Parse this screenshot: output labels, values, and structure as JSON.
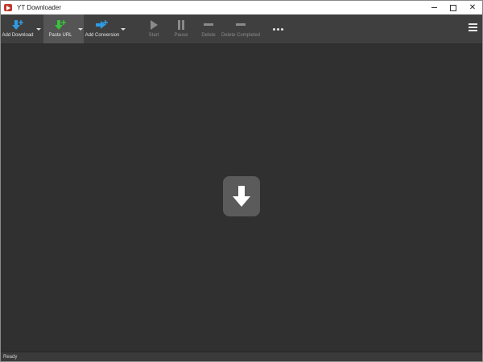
{
  "window": {
    "title": "YT Downloader",
    "controls": {
      "minimize": "",
      "maximize": "",
      "close": "✕"
    }
  },
  "toolbar": {
    "add_download": "Add Download",
    "paste_url": "Paste URL",
    "add_conversion": "Add Conversion",
    "start": "Start",
    "pause": "Pause",
    "delete": "Delete",
    "delete_completed": "Delete Completed",
    "more_icon": "more-dots-icon",
    "menu_icon": "hamburger-menu-icon"
  },
  "main": {
    "drop_icon": "download-arrow-icon"
  },
  "status": {
    "text": "Ready"
  },
  "colors": {
    "add_download_accent": "#2f9be3",
    "paste_url_accent": "#38c13c",
    "add_conversion_accent": "#2f9be3",
    "background": "#303030",
    "toolbar": "#3f3f3f"
  }
}
